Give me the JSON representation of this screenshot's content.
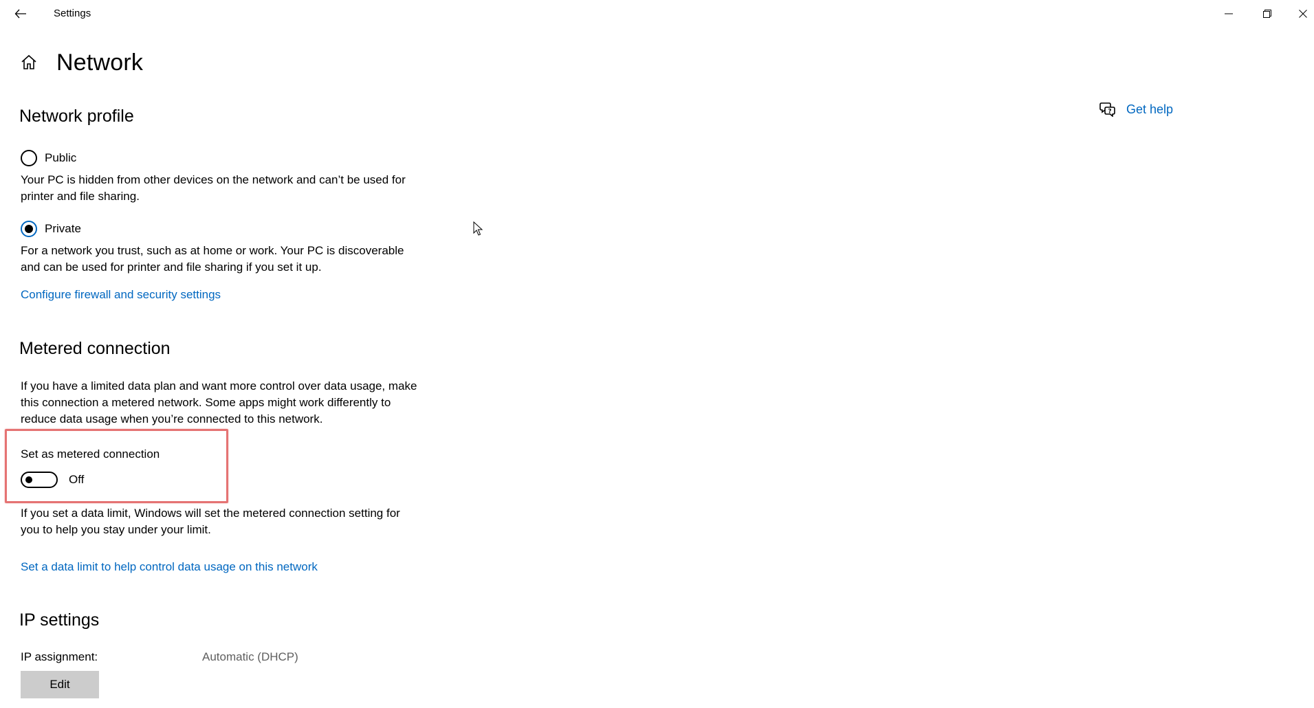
{
  "window": {
    "title": "Settings",
    "icons": {
      "back": "arrow-left-icon",
      "minimize": "minimize-icon",
      "maximize": "restore-icon",
      "close": "close-icon"
    }
  },
  "header": {
    "home_icon": "home-icon",
    "title": "Network"
  },
  "help": {
    "icon": "chat-help-icon",
    "label": "Get help"
  },
  "network_profile": {
    "title": "Network profile",
    "options": [
      {
        "label": "Public",
        "description": "Your PC is hidden from other devices on the network and can’t be used for printer and file sharing.",
        "selected": false
      },
      {
        "label": "Private",
        "description": "For a network you trust, such as at home or work. Your PC is discoverable and can be used for printer and file sharing if you set it up.",
        "selected": true
      }
    ],
    "link": "Configure firewall and security settings"
  },
  "metered": {
    "title": "Metered connection",
    "description": "If you have a limited data plan and want more control over data usage, make this connection a metered network. Some apps might work differently to reduce data usage when you’re connected to this network.",
    "toggle_label": "Set as metered connection",
    "toggle_state": "Off",
    "toggle_on": false,
    "data_limit_text": "If you set a data limit, Windows will set the metered connection setting for you to help you stay under your limit.",
    "data_limit_link": "Set a data limit to help control data usage on this network"
  },
  "ip": {
    "title": "IP settings",
    "assignment_label": "IP assignment:",
    "assignment_value": "Automatic (DHCP)",
    "edit_label": "Edit"
  },
  "colors": {
    "accent": "#0067c0",
    "highlight": "#e57373",
    "button_bg": "#cccccc"
  }
}
